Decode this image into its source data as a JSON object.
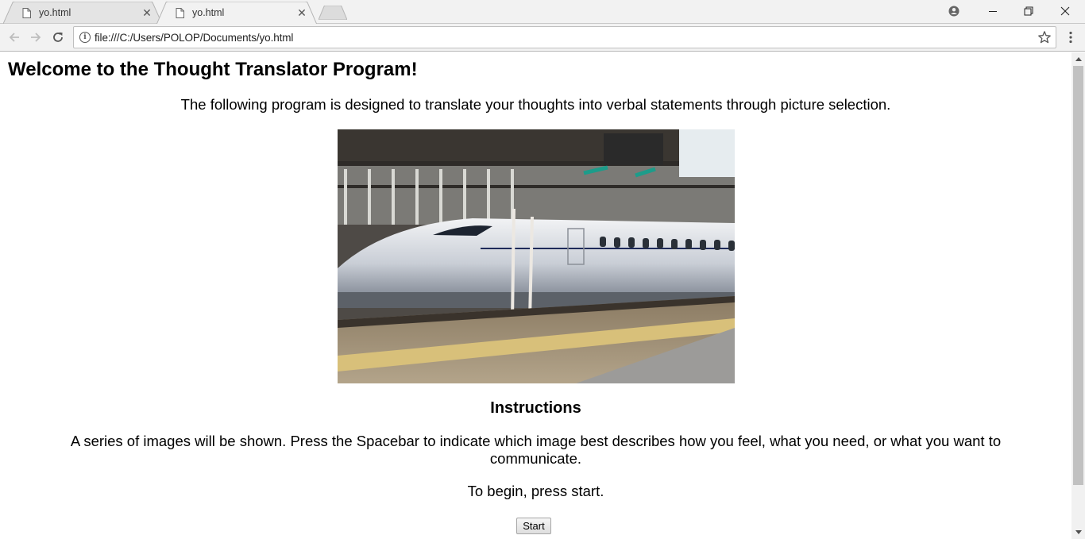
{
  "browser": {
    "tabs": [
      {
        "title": "yo.html",
        "active": false
      },
      {
        "title": "yo.html",
        "active": true
      }
    ],
    "address_bar": {
      "url": "file:///C:/Users/POLOP/Documents/yo.html"
    },
    "icons": {
      "back": "arrow-left-icon",
      "forward": "arrow-right-icon",
      "reload": "reload-icon",
      "info": "info-icon",
      "bookmark": "star-icon",
      "menu": "three-dots-vertical-icon",
      "profile": "profile-icon",
      "minimize": "minimize-icon",
      "restore": "restore-icon",
      "close": "close-icon"
    }
  },
  "page": {
    "heading": "Welcome to the Thought Translator Program!",
    "intro": "The following program is designed to translate your thoughts into verbal statements through picture selection.",
    "image": {
      "subject": "bullet train at station platform"
    },
    "instructions_heading": "Instructions",
    "instructions_text": "A series of images will be shown. Press the Spacebar to indicate which image best describes how you feel, what you need, or what you want to communicate.",
    "begin_text": "To begin, press start.",
    "start_button": "Start"
  },
  "colors": {
    "chrome_bg": "#f2f2f2",
    "page_bg": "#ffffff",
    "text": "#000000"
  }
}
